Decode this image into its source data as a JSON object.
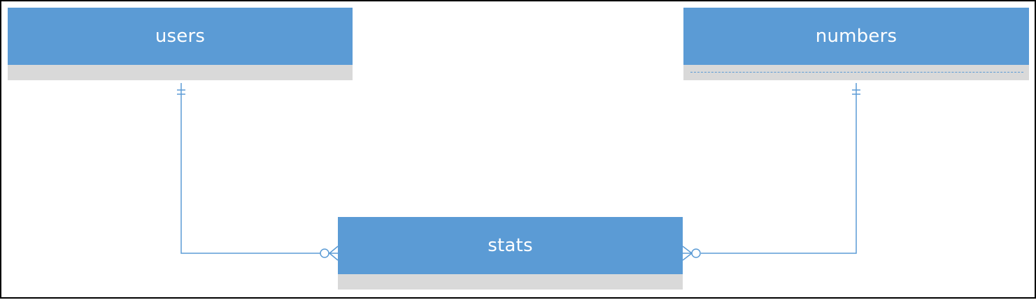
{
  "diagram": {
    "entities": [
      {
        "id": "users",
        "title": "users",
        "dashed_separator": false
      },
      {
        "id": "numbers",
        "title": "numbers",
        "dashed_separator": true
      },
      {
        "id": "stats",
        "title": "stats",
        "dashed_separator": false
      }
    ],
    "relationships": [
      {
        "from": "users",
        "to": "stats",
        "from_cardinality": "one-and-only-one",
        "to_cardinality": "zero-or-many"
      },
      {
        "from": "numbers",
        "to": "stats",
        "from_cardinality": "one-and-only-one",
        "to_cardinality": "zero-or-many"
      }
    ],
    "colors": {
      "header": "#5b9bd5",
      "body": "#d9d9d9",
      "line": "#5b9bd5",
      "border": "#000000",
      "title_text": "#ffffff"
    }
  }
}
